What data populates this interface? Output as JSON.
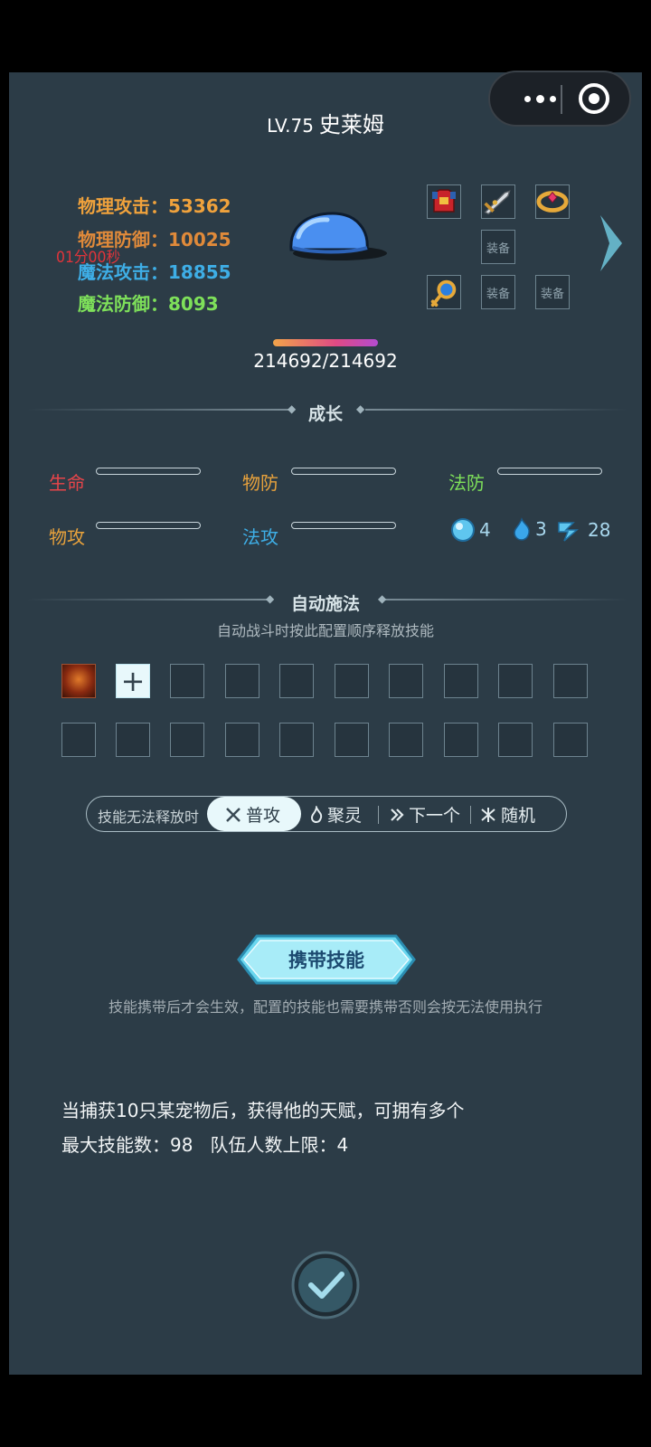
{
  "header": {
    "level": "LV.75",
    "name": "史莱姆"
  },
  "stats": [
    {
      "label": "物理攻击：",
      "value": "53362",
      "label_color": "#f0a23c",
      "value_color": "#f0a23c"
    },
    {
      "label": "物理防御：",
      "value": "10025",
      "label_color": "#e08a3a",
      "value_color": "#e08a3a"
    },
    {
      "label": "魔法攻击：",
      "value": "18855",
      "label_color": "#3eaee6",
      "value_color": "#3eaee6"
    },
    {
      "label": "魔法防御：",
      "value": "8093",
      "label_color": "#7ee05a",
      "value_color": "#7ee05a"
    }
  ],
  "timer": "01分00秒",
  "equipment": {
    "empty_label": "装备"
  },
  "hp": {
    "current": 214692,
    "max": 214692,
    "text": "214692/214692"
  },
  "growth": {
    "title": "成长",
    "items": [
      {
        "label": "生命",
        "color": "#e8454a"
      },
      {
        "label": "物防",
        "color": "#e8a23c"
      },
      {
        "label": "法防",
        "color": "#7ee05a"
      },
      {
        "label": "物攻",
        "color": "#e8a23c"
      },
      {
        "label": "法攻",
        "color": "#3eaee6"
      }
    ],
    "resources": [
      {
        "icon": "orb-icon",
        "value": "4"
      },
      {
        "icon": "flame-icon",
        "value": "3"
      },
      {
        "icon": "speed-icon",
        "value": "28"
      }
    ]
  },
  "auto_cast": {
    "title": "自动施法",
    "subtitle": "自动战斗时按此配置顺序释放技能",
    "slot_count": 20
  },
  "fallback": {
    "label": "技能无法释放时",
    "options": [
      {
        "icon": "crossed-swords-icon",
        "text": "普攻",
        "active": true
      },
      {
        "icon": "spirit-icon",
        "text": "聚灵",
        "active": false
      },
      {
        "icon": "double-chevron-icon",
        "text": "下一个",
        "active": false
      },
      {
        "icon": "random-icon",
        "text": "随机",
        "active": false
      }
    ]
  },
  "carry": {
    "button": "携带技能",
    "note": "技能携带后才会生效，配置的技能也需要携带否则会按无法使用执行"
  },
  "info": {
    "line1": "当捕获10只某宠物后，获得他的天赋，可拥有多个",
    "line2": "最大技能数：98   队伍人数上限：4"
  }
}
